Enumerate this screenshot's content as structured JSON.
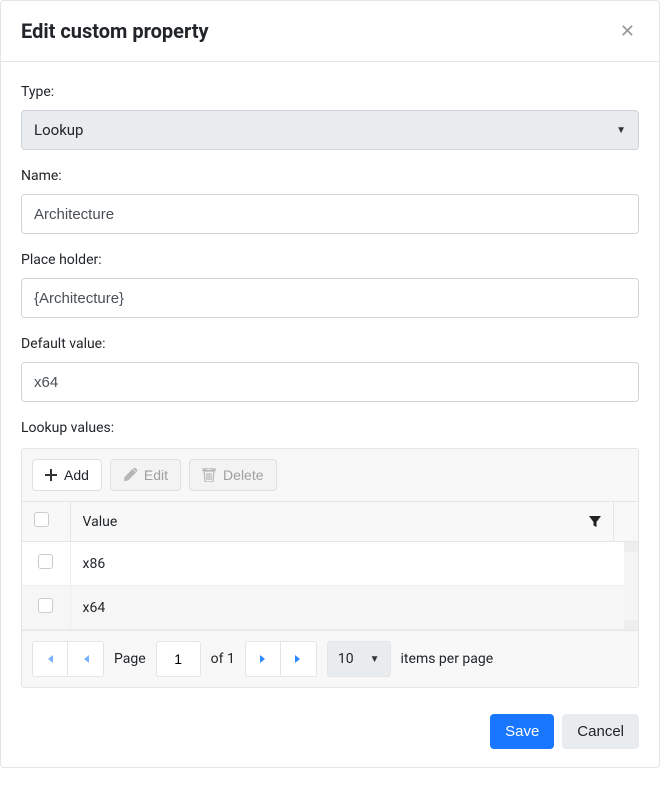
{
  "header": {
    "title": "Edit custom property"
  },
  "form": {
    "type": {
      "label": "Type:",
      "value": "Lookup"
    },
    "name": {
      "label": "Name:",
      "value": "Architecture"
    },
    "placeholder": {
      "label": "Place holder:",
      "value": "{Architecture}"
    },
    "default_value": {
      "label": "Default value:",
      "value": "x64"
    },
    "lookup_label": "Lookup values:"
  },
  "toolbar": {
    "add": "Add",
    "edit": "Edit",
    "delete": "Delete"
  },
  "grid": {
    "header_value": "Value",
    "rows": [
      "x86",
      "x64"
    ]
  },
  "pager": {
    "page_label": "Page",
    "current": "1",
    "of_label": "of 1",
    "page_size": "10",
    "items_label": "items per page"
  },
  "footer": {
    "save": "Save",
    "cancel": "Cancel"
  }
}
